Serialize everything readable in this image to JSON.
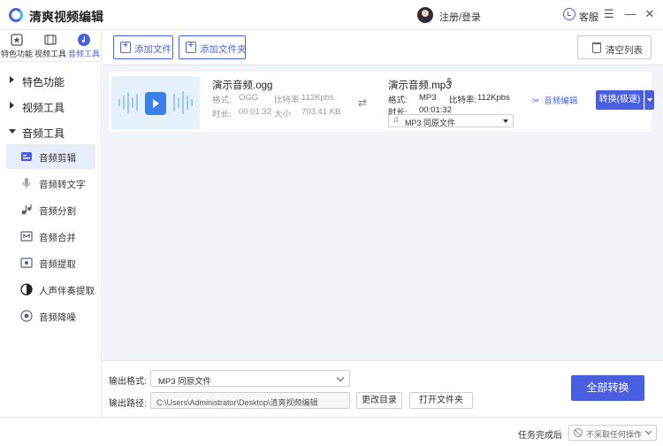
{
  "app": {
    "title": "清爽视频编辑"
  },
  "header": {
    "login": "注册/登录",
    "service": "客服",
    "menu_glyph": "☰",
    "minimize_glyph": "—",
    "close_glyph": "✕"
  },
  "sidebar": {
    "top_tabs": [
      {
        "label": "特色功能",
        "icon": "star-icon"
      },
      {
        "label": "视频工具",
        "icon": "film-icon"
      },
      {
        "label": "音频工具",
        "icon": "music-note-icon",
        "active": true
      }
    ],
    "categories": [
      {
        "label": "特色功能",
        "expanded": false
      },
      {
        "label": "视频工具",
        "expanded": false
      },
      {
        "label": "音频工具",
        "expanded": true
      }
    ],
    "items": [
      {
        "label": "音频剪辑",
        "icon": "audio-cut-icon",
        "active": true
      },
      {
        "label": "音频转文字",
        "icon": "microphone-icon"
      },
      {
        "label": "音频分割",
        "icon": "split-icon"
      },
      {
        "label": "音频合并",
        "icon": "merge-icon"
      },
      {
        "label": "音频提取",
        "icon": "extract-icon"
      },
      {
        "label": "人声伴奏提取",
        "icon": "voice-icon"
      },
      {
        "label": "音频降噪",
        "icon": "denoise-icon"
      }
    ]
  },
  "toolbar": {
    "add_file": "添加文件",
    "add_folder": "添加文件夹",
    "clear_list": "清空列表"
  },
  "file": {
    "source": {
      "name": "演示音频.ogg",
      "format_label": "格式:",
      "format": "OGG",
      "bitrate_label": "比特率:",
      "bitrate": "112Kpbs",
      "duration_label": "时长:",
      "duration": "00:01:32",
      "size_label": "大小",
      "size": "703.41 KB"
    },
    "target": {
      "name": "演示音频.mp3",
      "format_label": "格式:",
      "format": "MP3",
      "bitrate_label": "比特率:",
      "bitrate": "112Kpbs",
      "duration_label": "时长:",
      "duration": "00:01:32",
      "select_value": "MP3  同原文件"
    },
    "edit_label": "音频编辑",
    "convert_label": "转换(极速)"
  },
  "output": {
    "format_label": "输出格式:",
    "format_value": "MP3  同原文件",
    "path_label": "输出路径:",
    "path_value": "C:\\Users\\Administrator\\Desktop\\清爽视频编辑",
    "change_dir": "更改目录",
    "open_folder": "打开文件夹",
    "convert_all": "全部转换"
  },
  "status": {
    "after_label": "任务完成后",
    "after_value": "不采取任何操作"
  },
  "colors": {
    "accent": "#4a5fe0",
    "active_bg": "#e8edfb",
    "main_bg": "#f3f4f7"
  }
}
